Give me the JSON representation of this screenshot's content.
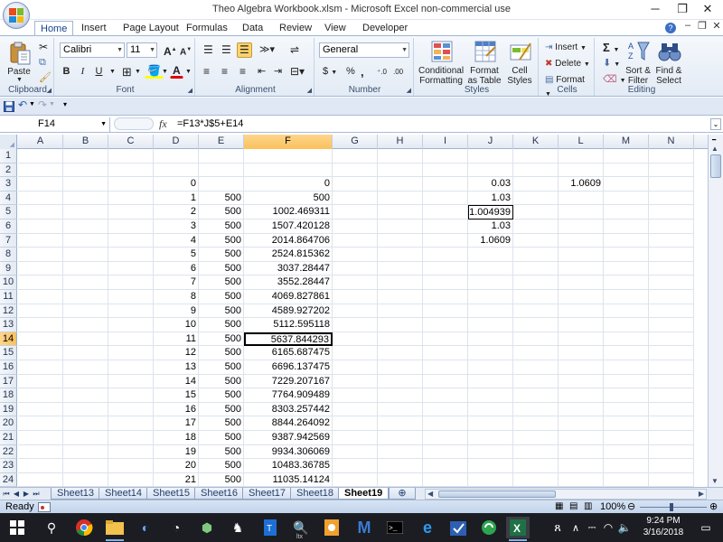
{
  "window": {
    "title": "Theo Algebra Workbook.xlsm - Microsoft Excel non-commercial use",
    "controls": {
      "minimize": "─",
      "restore": "❐",
      "close": "✕"
    },
    "help": "?",
    "doc_controls": {
      "minimize": "–",
      "restore": "❐",
      "close": "✕"
    }
  },
  "ribbon": {
    "tabs": [
      "Home",
      "Insert",
      "Page Layout",
      "Formulas",
      "Data",
      "Review",
      "View",
      "Developer"
    ],
    "active_tab": "Home",
    "clipboard": {
      "paste": "Paste",
      "label": "Clipboard"
    },
    "font": {
      "name": "Calibri",
      "size": "11",
      "label": "Font",
      "bold": "B",
      "italic": "I",
      "underline": "U",
      "grow": "A",
      "shrink": "A",
      "color_glyph": "A"
    },
    "alignment": {
      "label": "Alignment"
    },
    "number": {
      "format": "General",
      "currency": "$",
      "percent": "%",
      "comma": ",",
      "label": "Number"
    },
    "styles": {
      "conditional_1": "Conditional",
      "conditional_2": "Formatting",
      "table_1": "Format",
      "table_2": "as Table",
      "cell_1": "Cell",
      "cell_2": "Styles",
      "label": "Styles"
    },
    "cells": {
      "insert": "Insert",
      "delete": "Delete",
      "format": "Format",
      "label": "Cells"
    },
    "editing": {
      "sort_1": "Sort &",
      "sort_2": "Filter",
      "find_1": "Find &",
      "find_2": "Select",
      "sigma": "Σ",
      "label": "Editing"
    }
  },
  "formula_bar": {
    "name_box": "F14",
    "fx": "fx",
    "formula": "=F13*J$5+E14"
  },
  "columns": [
    "A",
    "B",
    "C",
    "D",
    "E",
    "F",
    "G",
    "H",
    "I",
    "J",
    "K",
    "L",
    "M",
    "N"
  ],
  "selected_column": "F",
  "selected_row": "14",
  "row_numbers": [
    "1",
    "2",
    "3",
    "4",
    "5",
    "6",
    "7",
    "8",
    "9",
    "10",
    "11",
    "12",
    "13",
    "14",
    "15",
    "16",
    "17",
    "18",
    "19",
    "20",
    "21",
    "22",
    "23",
    "24"
  ],
  "cells": {
    "D": [
      "",
      "",
      "0",
      "1",
      "2",
      "3",
      "4",
      "5",
      "6",
      "7",
      "8",
      "9",
      "10",
      "11",
      "12",
      "13",
      "14",
      "15",
      "16",
      "17",
      "18",
      "19",
      "20",
      "21"
    ],
    "E": [
      "",
      "",
      "",
      "500",
      "500",
      "500",
      "500",
      "500",
      "500",
      "500",
      "500",
      "500",
      "500",
      "500",
      "500",
      "500",
      "500",
      "500",
      "500",
      "500",
      "500",
      "500",
      "500",
      "500"
    ],
    "F": [
      "",
      "",
      "0",
      "500",
      "1002.469311",
      "1507.420128",
      "2014.864706",
      "2524.815362",
      "3037.28447",
      "3552.28447",
      "4069.827861",
      "4589.927202",
      "5112.595118",
      "5637.844293",
      "6165.687475",
      "6696.137475",
      "7229.207167",
      "7764.909489",
      "8303.257442",
      "8844.264092",
      "9387.942569",
      "9934.306069",
      "10483.36785",
      "11035.14124"
    ],
    "J": [
      "",
      "",
      "0.03",
      "1.03",
      "1.004939",
      "1.03",
      "1.0609",
      "",
      "",
      "",
      "",
      "",
      "",
      "",
      "",
      "",
      "",
      "",
      "",
      "",
      "",
      "",
      "",
      ""
    ],
    "L": [
      "",
      "",
      "1.0609",
      "",
      "",
      "",
      "",
      "",
      "",
      "",
      "",
      "",
      "",
      "",
      "",
      "",
      "",
      "",
      "",
      "",
      "",
      "",
      "",
      ""
    ]
  },
  "sheets": [
    "Sheet13",
    "Sheet14",
    "Sheet15",
    "Sheet16",
    "Sheet17",
    "Sheet18",
    "Sheet19"
  ],
  "active_sheet": "Sheet19",
  "status": {
    "ready": "Ready",
    "zoom": "100%"
  },
  "taskbar": {
    "time": "9:24 PM",
    "date": "3/16/2018",
    "search_label": "ltx"
  },
  "colors": {
    "selected_header": "#f9c15a",
    "ribbon_bg": "#e3ebf5",
    "taskbar_bg": "#1b1d22"
  }
}
